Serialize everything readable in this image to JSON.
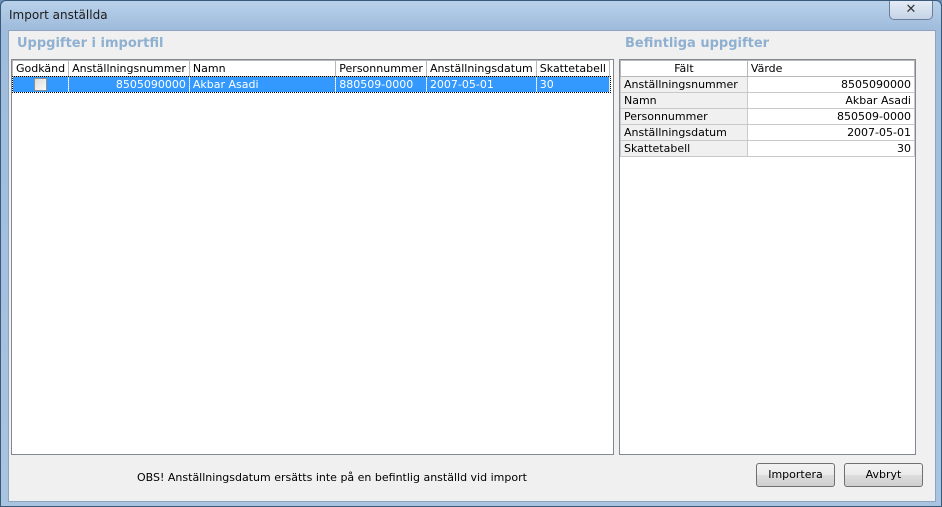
{
  "window": {
    "title": "Import anställda",
    "close_glyph": "✕"
  },
  "left": {
    "title": "Uppgifter i importfil",
    "columns": [
      "Godkänd",
      "Anställningsnummer",
      "Namn",
      "Personnummer",
      "Anställningsdatum",
      "Skattetabell"
    ],
    "rows": [
      {
        "approved": false,
        "anstallningsnummer": "8505090000",
        "namn": "Akbar Asadi",
        "personnummer": "880509-0000",
        "anstallningsdatum": "2007-05-01",
        "skattetabell": "30"
      }
    ]
  },
  "right": {
    "title": "Befintliga uppgifter",
    "columns": [
      "Fält",
      "Värde"
    ],
    "rows": [
      {
        "field": "Anställningsnummer",
        "value": "8505090000"
      },
      {
        "field": "Namn",
        "value": "Akbar Asadi"
      },
      {
        "field": "Personnummer",
        "value": "850509-0000"
      },
      {
        "field": "Anställningsdatum",
        "value": "2007-05-01"
      },
      {
        "field": "Skattetabell",
        "value": "30"
      }
    ]
  },
  "footer": {
    "note": "OBS! Anställningsdatum ersätts inte på en befintlig anställd vid import",
    "import_label": "Importera",
    "cancel_label": "Avbryt"
  }
}
